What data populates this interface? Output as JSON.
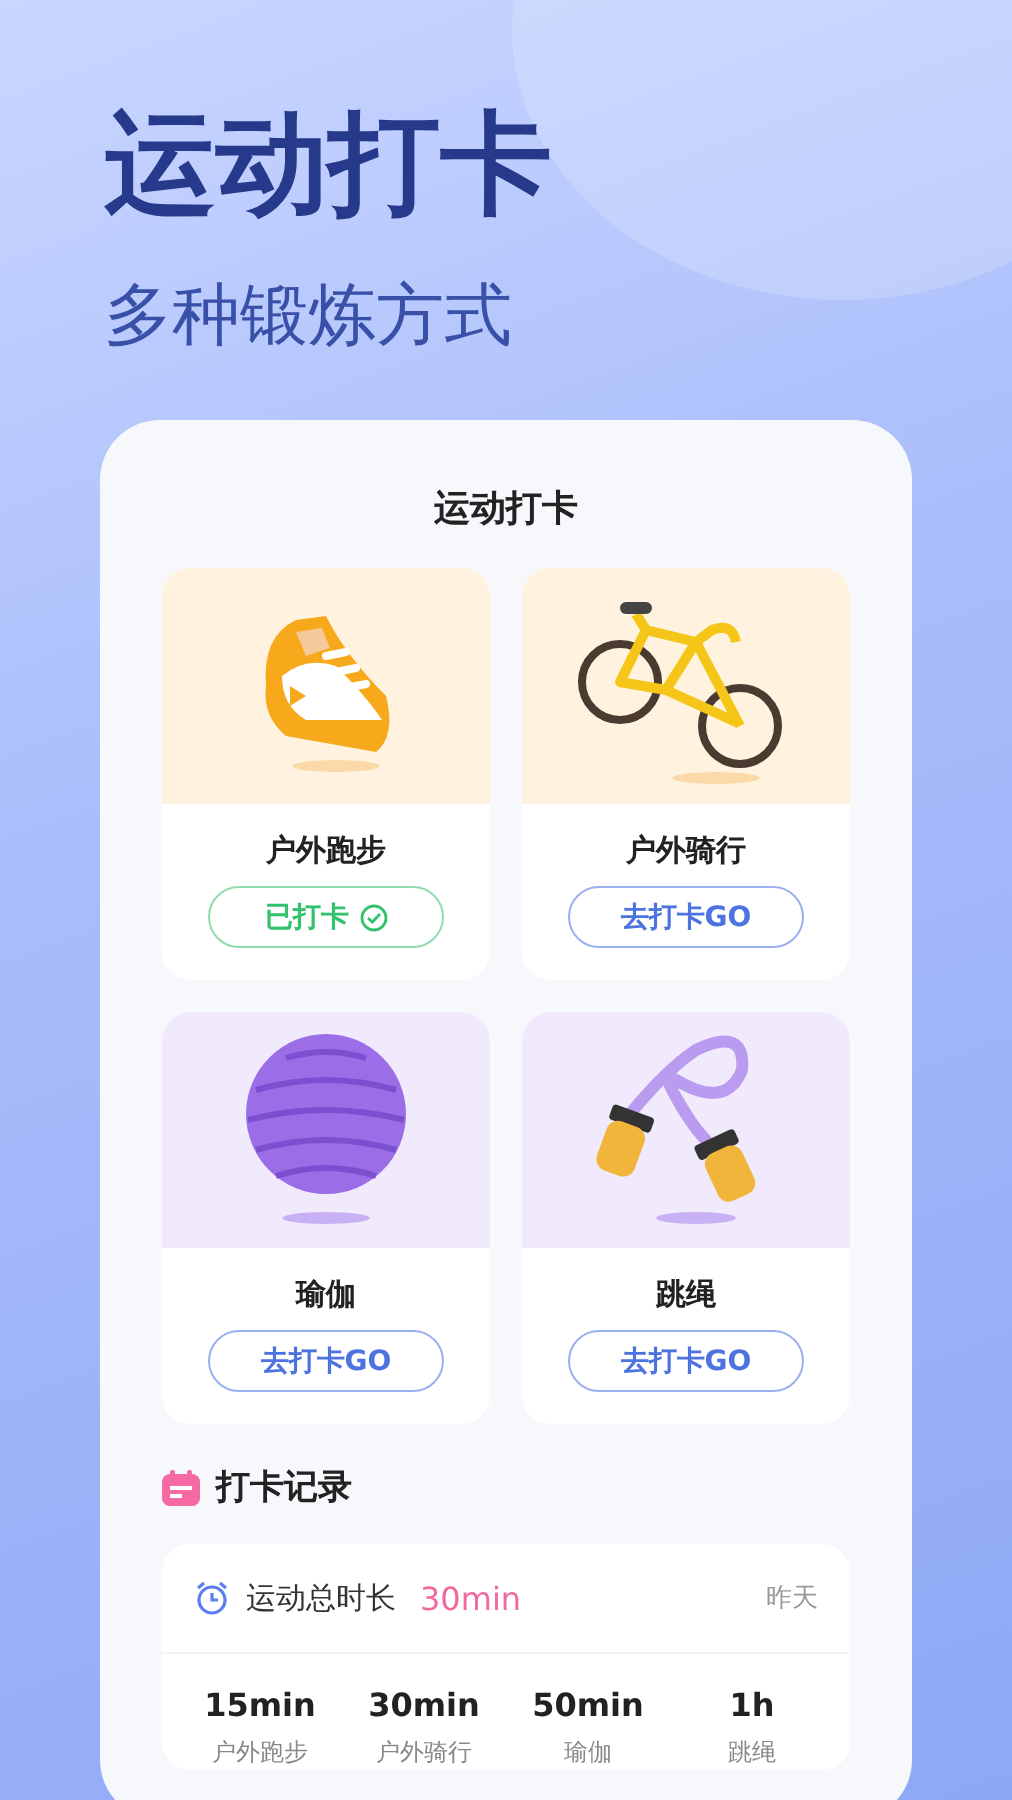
{
  "headline": "运动打卡",
  "subtitle": "多种锻炼方式",
  "card": {
    "title": "运动打卡",
    "activities": [
      {
        "kind": "shoe",
        "name": "户外跑步",
        "checked": true,
        "button": "已打卡"
      },
      {
        "kind": "bike",
        "name": "户外骑行",
        "checked": false,
        "button": "去打卡GO"
      },
      {
        "kind": "ball",
        "name": "瑜伽",
        "checked": false,
        "button": "去打卡GO"
      },
      {
        "kind": "rope",
        "name": "跳绳",
        "checked": false,
        "button": "去打卡GO"
      }
    ],
    "record": {
      "title": "打卡记录",
      "summary_label": "运动总时长",
      "summary_value": "30min",
      "date": "昨天",
      "stats": [
        {
          "value": "15min",
          "label": "户外跑步"
        },
        {
          "value": "30min",
          "label": "户外骑行"
        },
        {
          "value": "50min",
          "label": "瑜伽"
        },
        {
          "value": "1h",
          "label": "跳绳"
        }
      ]
    }
  }
}
